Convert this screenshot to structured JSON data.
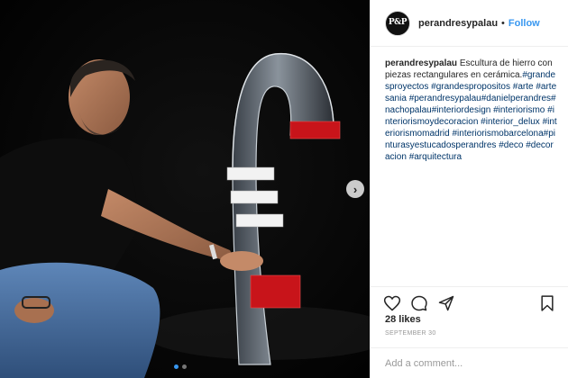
{
  "post": {
    "username": "perandresypalau",
    "separator": "•",
    "follow_label": "Follow",
    "avatar_text": "P&P",
    "caption_user": "perandresypalau",
    "caption_parts": [
      {
        "t": "text",
        "v": " Escultura de hierro con piezas rectangulares en cerámica."
      },
      {
        "t": "tag",
        "v": "#grandesproyectos"
      },
      {
        "t": "text",
        "v": " "
      },
      {
        "t": "tag",
        "v": "#grandespropositos"
      },
      {
        "t": "text",
        "v": " "
      },
      {
        "t": "tag",
        "v": "#arte"
      },
      {
        "t": "text",
        "v": " "
      },
      {
        "t": "tag",
        "v": "#artesania"
      },
      {
        "t": "text",
        "v": " "
      },
      {
        "t": "tag",
        "v": "#perandresypalau"
      },
      {
        "t": "tag",
        "v": "#danielperandres"
      },
      {
        "t": "tag",
        "v": "#nachopalau"
      },
      {
        "t": "tag",
        "v": "#interiordesign"
      },
      {
        "t": "text",
        "v": " "
      },
      {
        "t": "tag",
        "v": "#interiorismo"
      },
      {
        "t": "text",
        "v": " "
      },
      {
        "t": "tag",
        "v": "#interiorismoydecoracion"
      },
      {
        "t": "text",
        "v": " "
      },
      {
        "t": "tag",
        "v": "#interior_delux"
      },
      {
        "t": "text",
        "v": " "
      },
      {
        "t": "tag",
        "v": "#interiorismomadrid"
      },
      {
        "t": "text",
        "v": " "
      },
      {
        "t": "tag",
        "v": "#interiorismobarcelona"
      },
      {
        "t": "tag",
        "v": "#pinturasyestucadosperandres"
      },
      {
        "t": "text",
        "v": " "
      },
      {
        "t": "tag",
        "v": "#deco"
      },
      {
        "t": "text",
        "v": " "
      },
      {
        "t": "tag",
        "v": "#decoracion"
      },
      {
        "t": "text",
        "v": " "
      },
      {
        "t": "tag",
        "v": "#arquitectura"
      }
    ],
    "likes": "28 likes",
    "date": "SEPTEMBER 30",
    "comment_placeholder": "Add a comment...",
    "carousel": {
      "count": 2,
      "active": 0,
      "next_glyph": "›"
    }
  },
  "icons": {
    "heart": "heart-icon",
    "comment": "comment-icon",
    "share": "share-icon",
    "save": "bookmark-icon",
    "next": "chevron-right-icon"
  },
  "colors": {
    "accent": "#3897f0",
    "hashtag": "#003569",
    "ceramic_red": "#c8141a",
    "ceramic_white": "#f2f2f2"
  }
}
